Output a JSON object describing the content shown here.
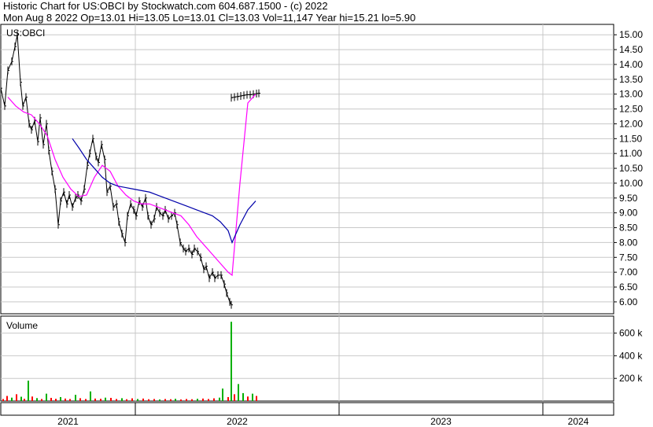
{
  "header": {
    "line1": "Historic Chart for US:OBCI by Stockwatch.com 604.687.1500 - (c) 2022",
    "line2": "Mon Aug  8 2022   Op=13.01   Hi=13.05   Lo=13.01   Cl=13.03   Vol=11,147   Year hi=15.21   lo=5.90"
  },
  "chart_data": [
    {
      "type": "line",
      "panel": "price",
      "title": "US:OBCI",
      "ylim": [
        5.6,
        15.35
      ],
      "y_ticks": [
        "15.00",
        "14.50",
        "14.00",
        "13.50",
        "13.00",
        "12.50",
        "12.00",
        "11.50",
        "11.00",
        "10.50",
        "10.00",
        "9.50",
        "9.00",
        "8.50",
        "8.00",
        "7.50",
        "7.00",
        "6.50",
        "6.00"
      ],
      "x_labels": [
        "2021",
        "2022",
        "2023",
        "2024"
      ],
      "grid": true,
      "series": [
        {
          "style": "price-bars",
          "color": "#000000",
          "x": [
            0,
            5,
            9,
            14,
            18,
            21,
            25,
            28,
            32,
            36,
            39,
            43,
            47,
            50,
            54,
            58,
            61,
            65,
            69,
            73,
            76,
            80,
            84,
            87,
            91,
            95,
            98,
            102,
            106,
            110,
            113,
            117,
            121,
            124,
            128,
            132,
            135,
            139,
            143,
            147,
            150,
            154,
            158,
            161,
            165,
            169,
            172,
            176,
            180,
            184,
            187,
            191,
            195,
            198,
            202,
            206,
            209,
            213,
            217,
            221,
            224,
            228,
            232,
            235,
            239,
            243,
            246,
            250,
            254,
            258,
            261,
            265,
            269,
            272,
            276,
            280,
            284,
            287,
            291,
            293
          ],
          "y": [
            13.2,
            12.6,
            13.8,
            14.1,
            14.6,
            15.0,
            13.4,
            12.6,
            12.9,
            12.0,
            11.8,
            12.1,
            11.4,
            12.2,
            11.3,
            12.0,
            11.1,
            10.4,
            9.8,
            8.6,
            9.4,
            9.7,
            9.3,
            9.6,
            9.2,
            9.5,
            9.6,
            9.4,
            9.8,
            10.6,
            11.0,
            11.5,
            10.9,
            10.7,
            11.3,
            10.8,
            9.7,
            9.9,
            9.2,
            9.3,
            8.7,
            8.3,
            8.0,
            8.9,
            9.3,
            9.1,
            8.9,
            9.4,
            9.2,
            9.5,
            8.9,
            8.6,
            8.8,
            9.2,
            9.0,
            8.9,
            9.1,
            8.8,
            8.9,
            9.0,
            8.6,
            8.0,
            7.8,
            7.7,
            7.8,
            7.6,
            7.8,
            7.7,
            7.5,
            7.1,
            7.2,
            6.8,
            7.0,
            6.8,
            6.9,
            6.9,
            6.6,
            6.3,
            6.0,
            5.9
          ]
        },
        {
          "style": "price-bars",
          "color": "#000000",
          "x": [
            293,
            297,
            301,
            305,
            309,
            313,
            317,
            321,
            325,
            328
          ],
          "y": [
            12.88,
            12.9,
            12.92,
            12.94,
            12.96,
            12.98,
            12.98,
            13.0,
            13.02,
            13.03
          ]
        },
        {
          "style": "moving-average",
          "color": "#ff00ff",
          "x": [
            10,
            20,
            30,
            40,
            50,
            60,
            70,
            80,
            90,
            100,
            110,
            120,
            130,
            140,
            150,
            160,
            170,
            180,
            190,
            200,
            210,
            220,
            230,
            240,
            250,
            260,
            270,
            280,
            290,
            295,
            305,
            315,
            325
          ],
          "y": [
            12.9,
            12.6,
            12.4,
            12.3,
            12.0,
            11.6,
            10.8,
            10.2,
            9.8,
            9.55,
            9.6,
            10.2,
            10.6,
            10.4,
            9.9,
            9.6,
            9.4,
            9.3,
            9.3,
            9.2,
            9.1,
            9.0,
            8.9,
            8.6,
            8.2,
            7.9,
            7.6,
            7.3,
            7.0,
            6.9,
            10.0,
            12.7,
            13.0
          ]
        },
        {
          "style": "moving-average",
          "color": "#0000aa",
          "x": [
            92,
            100,
            110,
            120,
            130,
            140,
            150,
            160,
            170,
            180,
            190,
            200,
            210,
            220,
            230,
            240,
            250,
            260,
            270,
            280,
            290,
            295,
            305,
            315,
            325
          ],
          "y": [
            11.5,
            11.2,
            10.8,
            10.5,
            10.2,
            10.0,
            9.9,
            9.85,
            9.8,
            9.75,
            9.7,
            9.6,
            9.5,
            9.4,
            9.3,
            9.2,
            9.1,
            9.0,
            8.9,
            8.7,
            8.4,
            8.0,
            8.6,
            9.1,
            9.4
          ]
        }
      ]
    },
    {
      "type": "bar",
      "panel": "volume",
      "title": "Volume",
      "ylim": [
        0,
        750000
      ],
      "y_ticks": [
        "600 k",
        "400 k",
        "200 k"
      ],
      "y_tick_values": [
        600000,
        400000,
        200000
      ],
      "series": [
        {
          "x": [
            3,
            8,
            14,
            20,
            26,
            30,
            35,
            40,
            46,
            52,
            58,
            64,
            70,
            76,
            82,
            88,
            95,
            101,
            108,
            114,
            120,
            127,
            133,
            140,
            147,
            154,
            160,
            167,
            174,
            181,
            188,
            195,
            202,
            209,
            216,
            222,
            229,
            236,
            243,
            250,
            257,
            264,
            271,
            278,
            282,
            289,
            293,
            297,
            302,
            308,
            314,
            320,
            325
          ],
          "values": [
            18000,
            45000,
            30000,
            60000,
            38000,
            20000,
            180000,
            40000,
            26000,
            18000,
            65000,
            28000,
            20000,
            35000,
            22000,
            18000,
            55000,
            25000,
            18000,
            85000,
            22000,
            20000,
            30000,
            28000,
            18000,
            25000,
            16000,
            24000,
            18000,
            22000,
            16000,
            18000,
            14000,
            18000,
            16000,
            20000,
            14000,
            18000,
            16000,
            20000,
            22000,
            18000,
            24000,
            30000,
            110000,
            35000,
            700000,
            60000,
            150000,
            70000,
            40000,
            65000,
            45000
          ],
          "colors": [
            "#ff0000",
            "#ff0000",
            "#00b000",
            "#ff0000",
            "#00b000",
            "#ff0000",
            "#00b000",
            "#ff0000",
            "#00b000",
            "#ff0000",
            "#00b000",
            "#ff0000",
            "#ff0000",
            "#00b000",
            "#ff0000",
            "#ff0000",
            "#00b000",
            "#ff0000",
            "#ff0000",
            "#00b000",
            "#ff0000",
            "#ff0000",
            "#00b000",
            "#ff0000",
            "#ff0000",
            "#00b000",
            "#ff0000",
            "#ff0000",
            "#00b000",
            "#ff0000",
            "#ff0000",
            "#ff0000",
            "#00b000",
            "#ff0000",
            "#ff0000",
            "#00b000",
            "#ff0000",
            "#ff0000",
            "#ff0000",
            "#00b000",
            "#ff0000",
            "#ff0000",
            "#ff0000",
            "#00b000",
            "#00b000",
            "#ff0000",
            "#00b000",
            "#ff0000",
            "#00b000",
            "#00b000",
            "#ff0000",
            "#00b000",
            "#ff0000"
          ]
        }
      ]
    }
  ]
}
